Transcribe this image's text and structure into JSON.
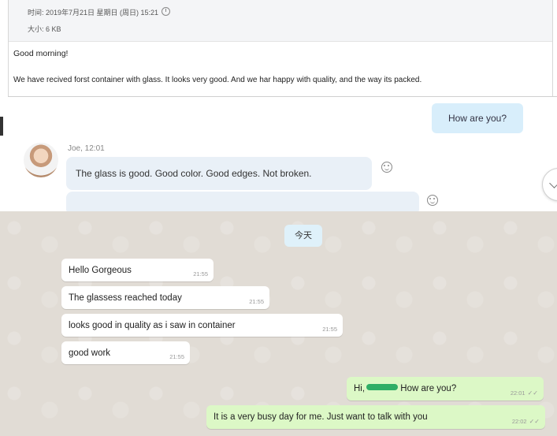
{
  "email": {
    "time_line": "时间: 2019年7月21日 星期日 (周日) 15:21",
    "size_line": "大小: 6 KB",
    "greeting": "Good morning!",
    "body": "We have recived forst container with glass. It looks very good. And we har happy with quality, and the way its packed."
  },
  "skype": {
    "outgoing": "How are you?",
    "sender": "Joe,  12:01",
    "incoming": "The glass is good. Good color. Good edges. Not broken."
  },
  "whatsapp": {
    "date_chip": "今天",
    "incoming": [
      {
        "text": "Hello Gorgeous",
        "time": "21:55"
      },
      {
        "text": "The glassess reached today",
        "time": "21:55"
      },
      {
        "text": "looks good in quality as i saw in container",
        "time": "21:55"
      },
      {
        "text": "good work",
        "time": "21:55"
      }
    ],
    "outgoing": [
      {
        "prefix": "Hi,",
        "text": "How are you?",
        "time": "22:01"
      },
      {
        "text": "It is a very busy day for me. Just want to talk with you",
        "time": "22:02"
      }
    ],
    "read_ticks": "✓✓"
  },
  "colors": {
    "outgoing_bubble": "#dcf8c6",
    "skype_bubble": "#d8eefb",
    "wa_background": "#e1dcd5"
  }
}
